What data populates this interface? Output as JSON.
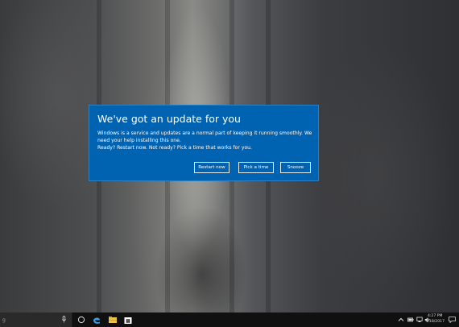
{
  "dialog": {
    "title": "We've got an update for you",
    "body_line1": "Windows is a service and updates are a normal part of keeping it running smoothly. We need your help installing this one.",
    "body_line2": "Ready? Restart now. Not ready? Pick a time that works for you.",
    "buttons": {
      "restart": "Restart now",
      "pick_time": "Pick a time",
      "snooze": "Snooze"
    },
    "accent": "#0063b1"
  },
  "taskbar": {
    "search_placeholder": "g",
    "pinned_icons": [
      "task-view-icon",
      "edge-icon",
      "file-explorer-icon",
      "store-icon"
    ],
    "tray_icons": [
      "chevron-up-icon",
      "battery-icon",
      "network-icon",
      "volume-icon"
    ],
    "clock": {
      "time": "4:27 PM",
      "date": "4/18/2017"
    }
  }
}
